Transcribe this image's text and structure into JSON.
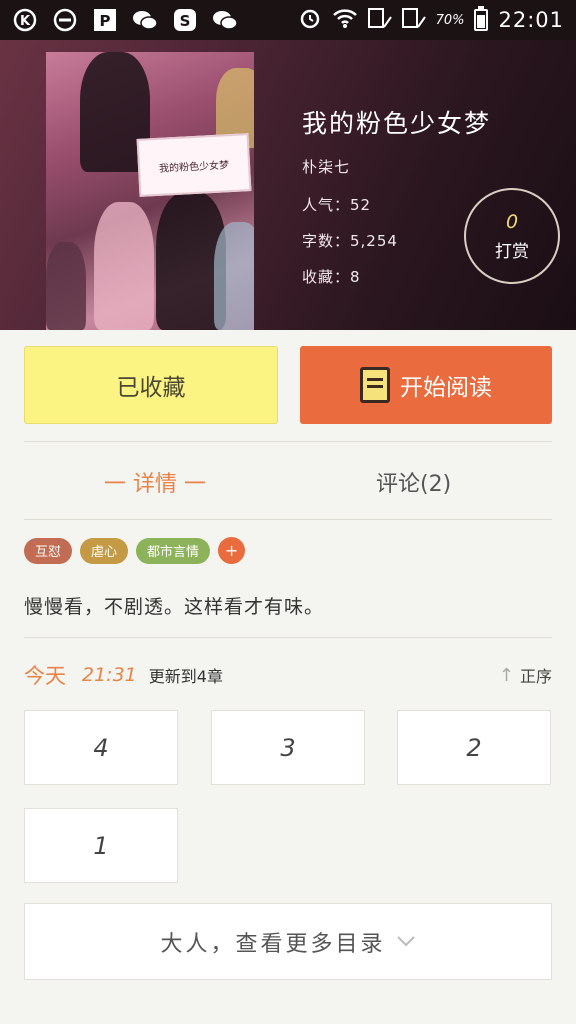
{
  "status_bar": {
    "battery_text": "70%",
    "battery_level": 0.7,
    "time": "22:01",
    "icons": [
      "k-app-icon",
      "minus-circle-icon",
      "p-app-icon",
      "wechat-icon",
      "s-app-icon",
      "wechat-icon",
      "alarm-icon",
      "wifi-icon",
      "signal-icon",
      "signal-icon"
    ]
  },
  "book": {
    "title": "我的粉色少女梦",
    "author": "朴柒七",
    "popularity": "人气：52",
    "word_count": "字数：5,254",
    "favorites": "收藏：8",
    "cover_caption": "我的粉色少女梦",
    "tip_count": "0",
    "tip_label": "打赏"
  },
  "actions": {
    "favorited_label": "已收藏",
    "read_label": "开始阅读"
  },
  "tabs": {
    "detail": "一 详情 一",
    "comments": "评论(2)"
  },
  "tags": [
    {
      "label": "互怼",
      "color": "#c26d53"
    },
    {
      "label": "虐心",
      "color": "#c59a45"
    },
    {
      "label": "都市言情",
      "color": "#8db35a"
    }
  ],
  "tag_add": "+",
  "description": "慢慢看，不剧透。这样看才有味。",
  "update": {
    "today": "今天",
    "time": "21:31",
    "text": "更新到4章",
    "sort_label": "正序"
  },
  "chapters": [
    "4",
    "3",
    "2",
    "1"
  ],
  "more_label": "大人，查看更多目录",
  "colors": {
    "accent": "#ea6b3d",
    "favorite_bg": "#fcf482",
    "highlight_text": "#e8844a"
  }
}
